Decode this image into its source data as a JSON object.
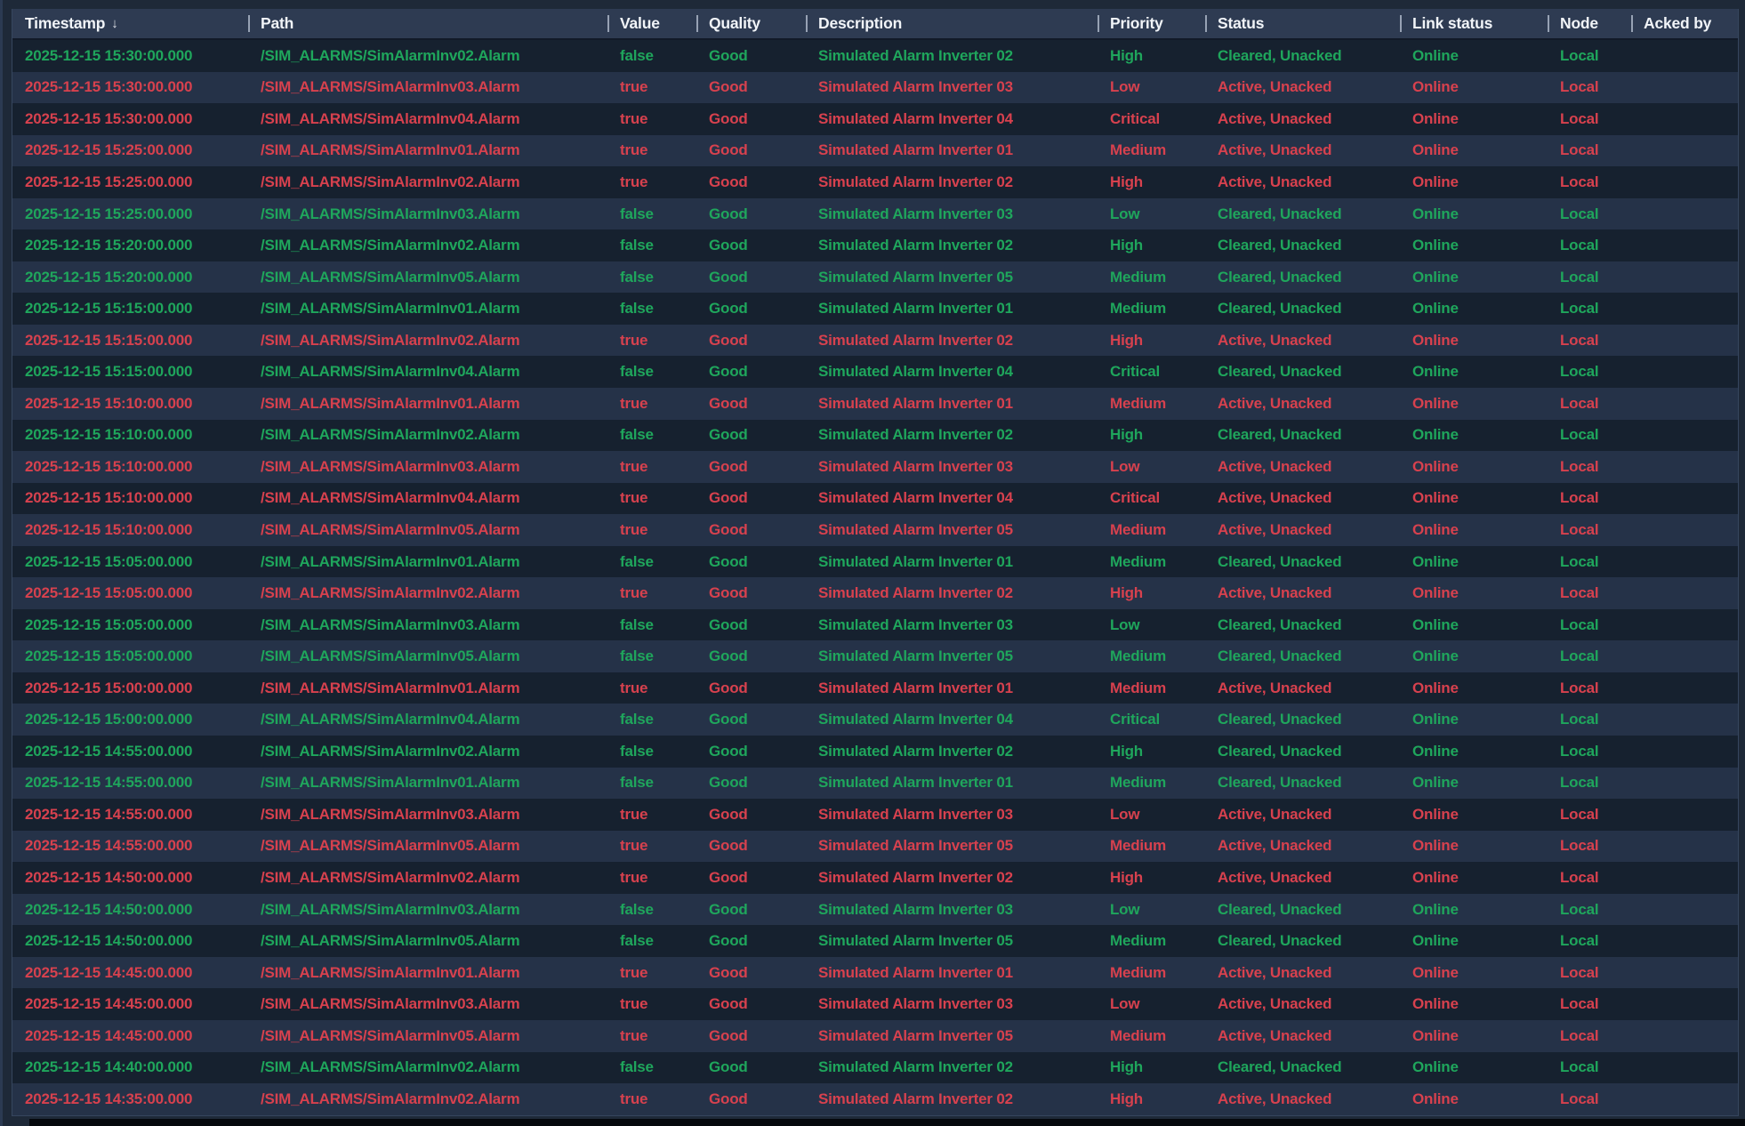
{
  "colors": {
    "outer_bg": "#1E2938",
    "edge_strip": "#2B3A52",
    "header_bg": "#2E3B52",
    "header_text": "#F1F4F8",
    "header_underline": "#121A28",
    "separator": "#97A2B4",
    "table_border": "#36465E",
    "row_dark": "#16212F",
    "row_light": "#253248",
    "green_text": "#1FA65C",
    "red_text": "#D7414E",
    "scrollbar_thumb": "#05080D"
  },
  "table": {
    "sort_icon": "↓",
    "sorted_column": "timestamp",
    "columns": [
      {
        "key": "timestamp",
        "label": "Timestamp"
      },
      {
        "key": "path",
        "label": "Path"
      },
      {
        "key": "value",
        "label": "Value"
      },
      {
        "key": "quality",
        "label": "Quality"
      },
      {
        "key": "description",
        "label": "Description"
      },
      {
        "key": "priority",
        "label": "Priority"
      },
      {
        "key": "status",
        "label": "Status"
      },
      {
        "key": "link_status",
        "label": "Link status"
      },
      {
        "key": "node",
        "label": "Node"
      },
      {
        "key": "acked_by",
        "label": "Acked by"
      }
    ],
    "rows": [
      {
        "timestamp": "2025-12-15 15:30:00.000",
        "path": "/SIM_ALARMS/SimAlarmInv02.Alarm",
        "value": "false",
        "quality": "Good",
        "description": "Simulated Alarm Inverter 02",
        "priority": "High",
        "status": "Cleared, Unacked",
        "link_status": "Online",
        "node": "Local",
        "acked_by": ""
      },
      {
        "timestamp": "2025-12-15 15:30:00.000",
        "path": "/SIM_ALARMS/SimAlarmInv03.Alarm",
        "value": "true",
        "quality": "Good",
        "description": "Simulated Alarm Inverter 03",
        "priority": "Low",
        "status": "Active, Unacked",
        "link_status": "Online",
        "node": "Local",
        "acked_by": ""
      },
      {
        "timestamp": "2025-12-15 15:30:00.000",
        "path": "/SIM_ALARMS/SimAlarmInv04.Alarm",
        "value": "true",
        "quality": "Good",
        "description": "Simulated Alarm Inverter 04",
        "priority": "Critical",
        "status": "Active, Unacked",
        "link_status": "Online",
        "node": "Local",
        "acked_by": ""
      },
      {
        "timestamp": "2025-12-15 15:25:00.000",
        "path": "/SIM_ALARMS/SimAlarmInv01.Alarm",
        "value": "true",
        "quality": "Good",
        "description": "Simulated Alarm Inverter 01",
        "priority": "Medium",
        "status": "Active, Unacked",
        "link_status": "Online",
        "node": "Local",
        "acked_by": ""
      },
      {
        "timestamp": "2025-12-15 15:25:00.000",
        "path": "/SIM_ALARMS/SimAlarmInv02.Alarm",
        "value": "true",
        "quality": "Good",
        "description": "Simulated Alarm Inverter 02",
        "priority": "High",
        "status": "Active, Unacked",
        "link_status": "Online",
        "node": "Local",
        "acked_by": ""
      },
      {
        "timestamp": "2025-12-15 15:25:00.000",
        "path": "/SIM_ALARMS/SimAlarmInv03.Alarm",
        "value": "false",
        "quality": "Good",
        "description": "Simulated Alarm Inverter 03",
        "priority": "Low",
        "status": "Cleared, Unacked",
        "link_status": "Online",
        "node": "Local",
        "acked_by": ""
      },
      {
        "timestamp": "2025-12-15 15:20:00.000",
        "path": "/SIM_ALARMS/SimAlarmInv02.Alarm",
        "value": "false",
        "quality": "Good",
        "description": "Simulated Alarm Inverter 02",
        "priority": "High",
        "status": "Cleared, Unacked",
        "link_status": "Online",
        "node": "Local",
        "acked_by": ""
      },
      {
        "timestamp": "2025-12-15 15:20:00.000",
        "path": "/SIM_ALARMS/SimAlarmInv05.Alarm",
        "value": "false",
        "quality": "Good",
        "description": "Simulated Alarm Inverter 05",
        "priority": "Medium",
        "status": "Cleared, Unacked",
        "link_status": "Online",
        "node": "Local",
        "acked_by": ""
      },
      {
        "timestamp": "2025-12-15 15:15:00.000",
        "path": "/SIM_ALARMS/SimAlarmInv01.Alarm",
        "value": "false",
        "quality": "Good",
        "description": "Simulated Alarm Inverter 01",
        "priority": "Medium",
        "status": "Cleared, Unacked",
        "link_status": "Online",
        "node": "Local",
        "acked_by": ""
      },
      {
        "timestamp": "2025-12-15 15:15:00.000",
        "path": "/SIM_ALARMS/SimAlarmInv02.Alarm",
        "value": "true",
        "quality": "Good",
        "description": "Simulated Alarm Inverter 02",
        "priority": "High",
        "status": "Active, Unacked",
        "link_status": "Online",
        "node": "Local",
        "acked_by": ""
      },
      {
        "timestamp": "2025-12-15 15:15:00.000",
        "path": "/SIM_ALARMS/SimAlarmInv04.Alarm",
        "value": "false",
        "quality": "Good",
        "description": "Simulated Alarm Inverter 04",
        "priority": "Critical",
        "status": "Cleared, Unacked",
        "link_status": "Online",
        "node": "Local",
        "acked_by": ""
      },
      {
        "timestamp": "2025-12-15 15:10:00.000",
        "path": "/SIM_ALARMS/SimAlarmInv01.Alarm",
        "value": "true",
        "quality": "Good",
        "description": "Simulated Alarm Inverter 01",
        "priority": "Medium",
        "status": "Active, Unacked",
        "link_status": "Online",
        "node": "Local",
        "acked_by": ""
      },
      {
        "timestamp": "2025-12-15 15:10:00.000",
        "path": "/SIM_ALARMS/SimAlarmInv02.Alarm",
        "value": "false",
        "quality": "Good",
        "description": "Simulated Alarm Inverter 02",
        "priority": "High",
        "status": "Cleared, Unacked",
        "link_status": "Online",
        "node": "Local",
        "acked_by": ""
      },
      {
        "timestamp": "2025-12-15 15:10:00.000",
        "path": "/SIM_ALARMS/SimAlarmInv03.Alarm",
        "value": "true",
        "quality": "Good",
        "description": "Simulated Alarm Inverter 03",
        "priority": "Low",
        "status": "Active, Unacked",
        "link_status": "Online",
        "node": "Local",
        "acked_by": ""
      },
      {
        "timestamp": "2025-12-15 15:10:00.000",
        "path": "/SIM_ALARMS/SimAlarmInv04.Alarm",
        "value": "true",
        "quality": "Good",
        "description": "Simulated Alarm Inverter 04",
        "priority": "Critical",
        "status": "Active, Unacked",
        "link_status": "Online",
        "node": "Local",
        "acked_by": ""
      },
      {
        "timestamp": "2025-12-15 15:10:00.000",
        "path": "/SIM_ALARMS/SimAlarmInv05.Alarm",
        "value": "true",
        "quality": "Good",
        "description": "Simulated Alarm Inverter 05",
        "priority": "Medium",
        "status": "Active, Unacked",
        "link_status": "Online",
        "node": "Local",
        "acked_by": ""
      },
      {
        "timestamp": "2025-12-15 15:05:00.000",
        "path": "/SIM_ALARMS/SimAlarmInv01.Alarm",
        "value": "false",
        "quality": "Good",
        "description": "Simulated Alarm Inverter 01",
        "priority": "Medium",
        "status": "Cleared, Unacked",
        "link_status": "Online",
        "node": "Local",
        "acked_by": ""
      },
      {
        "timestamp": "2025-12-15 15:05:00.000",
        "path": "/SIM_ALARMS/SimAlarmInv02.Alarm",
        "value": "true",
        "quality": "Good",
        "description": "Simulated Alarm Inverter 02",
        "priority": "High",
        "status": "Active, Unacked",
        "link_status": "Online",
        "node": "Local",
        "acked_by": ""
      },
      {
        "timestamp": "2025-12-15 15:05:00.000",
        "path": "/SIM_ALARMS/SimAlarmInv03.Alarm",
        "value": "false",
        "quality": "Good",
        "description": "Simulated Alarm Inverter 03",
        "priority": "Low",
        "status": "Cleared, Unacked",
        "link_status": "Online",
        "node": "Local",
        "acked_by": ""
      },
      {
        "timestamp": "2025-12-15 15:05:00.000",
        "path": "/SIM_ALARMS/SimAlarmInv05.Alarm",
        "value": "false",
        "quality": "Good",
        "description": "Simulated Alarm Inverter 05",
        "priority": "Medium",
        "status": "Cleared, Unacked",
        "link_status": "Online",
        "node": "Local",
        "acked_by": ""
      },
      {
        "timestamp": "2025-12-15 15:00:00.000",
        "path": "/SIM_ALARMS/SimAlarmInv01.Alarm",
        "value": "true",
        "quality": "Good",
        "description": "Simulated Alarm Inverter 01",
        "priority": "Medium",
        "status": "Active, Unacked",
        "link_status": "Online",
        "node": "Local",
        "acked_by": ""
      },
      {
        "timestamp": "2025-12-15 15:00:00.000",
        "path": "/SIM_ALARMS/SimAlarmInv04.Alarm",
        "value": "false",
        "quality": "Good",
        "description": "Simulated Alarm Inverter 04",
        "priority": "Critical",
        "status": "Cleared, Unacked",
        "link_status": "Online",
        "node": "Local",
        "acked_by": ""
      },
      {
        "timestamp": "2025-12-15 14:55:00.000",
        "path": "/SIM_ALARMS/SimAlarmInv02.Alarm",
        "value": "false",
        "quality": "Good",
        "description": "Simulated Alarm Inverter 02",
        "priority": "High",
        "status": "Cleared, Unacked",
        "link_status": "Online",
        "node": "Local",
        "acked_by": ""
      },
      {
        "timestamp": "2025-12-15 14:55:00.000",
        "path": "/SIM_ALARMS/SimAlarmInv01.Alarm",
        "value": "false",
        "quality": "Good",
        "description": "Simulated Alarm Inverter 01",
        "priority": "Medium",
        "status": "Cleared, Unacked",
        "link_status": "Online",
        "node": "Local",
        "acked_by": ""
      },
      {
        "timestamp": "2025-12-15 14:55:00.000",
        "path": "/SIM_ALARMS/SimAlarmInv03.Alarm",
        "value": "true",
        "quality": "Good",
        "description": "Simulated Alarm Inverter 03",
        "priority": "Low",
        "status": "Active, Unacked",
        "link_status": "Online",
        "node": "Local",
        "acked_by": ""
      },
      {
        "timestamp": "2025-12-15 14:55:00.000",
        "path": "/SIM_ALARMS/SimAlarmInv05.Alarm",
        "value": "true",
        "quality": "Good",
        "description": "Simulated Alarm Inverter 05",
        "priority": "Medium",
        "status": "Active, Unacked",
        "link_status": "Online",
        "node": "Local",
        "acked_by": ""
      },
      {
        "timestamp": "2025-12-15 14:50:00.000",
        "path": "/SIM_ALARMS/SimAlarmInv02.Alarm",
        "value": "true",
        "quality": "Good",
        "description": "Simulated Alarm Inverter 02",
        "priority": "High",
        "status": "Active, Unacked",
        "link_status": "Online",
        "node": "Local",
        "acked_by": ""
      },
      {
        "timestamp": "2025-12-15 14:50:00.000",
        "path": "/SIM_ALARMS/SimAlarmInv03.Alarm",
        "value": "false",
        "quality": "Good",
        "description": "Simulated Alarm Inverter 03",
        "priority": "Low",
        "status": "Cleared, Unacked",
        "link_status": "Online",
        "node": "Local",
        "acked_by": ""
      },
      {
        "timestamp": "2025-12-15 14:50:00.000",
        "path": "/SIM_ALARMS/SimAlarmInv05.Alarm",
        "value": "false",
        "quality": "Good",
        "description": "Simulated Alarm Inverter 05",
        "priority": "Medium",
        "status": "Cleared, Unacked",
        "link_status": "Online",
        "node": "Local",
        "acked_by": ""
      },
      {
        "timestamp": "2025-12-15 14:45:00.000",
        "path": "/SIM_ALARMS/SimAlarmInv01.Alarm",
        "value": "true",
        "quality": "Good",
        "description": "Simulated Alarm Inverter 01",
        "priority": "Medium",
        "status": "Active, Unacked",
        "link_status": "Online",
        "node": "Local",
        "acked_by": ""
      },
      {
        "timestamp": "2025-12-15 14:45:00.000",
        "path": "/SIM_ALARMS/SimAlarmInv03.Alarm",
        "value": "true",
        "quality": "Good",
        "description": "Simulated Alarm Inverter 03",
        "priority": "Low",
        "status": "Active, Unacked",
        "link_status": "Online",
        "node": "Local",
        "acked_by": ""
      },
      {
        "timestamp": "2025-12-15 14:45:00.000",
        "path": "/SIM_ALARMS/SimAlarmInv05.Alarm",
        "value": "true",
        "quality": "Good",
        "description": "Simulated Alarm Inverter 05",
        "priority": "Medium",
        "status": "Active, Unacked",
        "link_status": "Online",
        "node": "Local",
        "acked_by": ""
      },
      {
        "timestamp": "2025-12-15 14:40:00.000",
        "path": "/SIM_ALARMS/SimAlarmInv02.Alarm",
        "value": "false",
        "quality": "Good",
        "description": "Simulated Alarm Inverter 02",
        "priority": "High",
        "status": "Cleared, Unacked",
        "link_status": "Online",
        "node": "Local",
        "acked_by": ""
      },
      {
        "timestamp": "2025-12-15 14:35:00.000",
        "path": "/SIM_ALARMS/SimAlarmInv02.Alarm",
        "value": "true",
        "quality": "Good",
        "description": "Simulated Alarm Inverter 02",
        "priority": "High",
        "status": "Active, Unacked",
        "link_status": "Online",
        "node": "Local",
        "acked_by": ""
      }
    ]
  }
}
